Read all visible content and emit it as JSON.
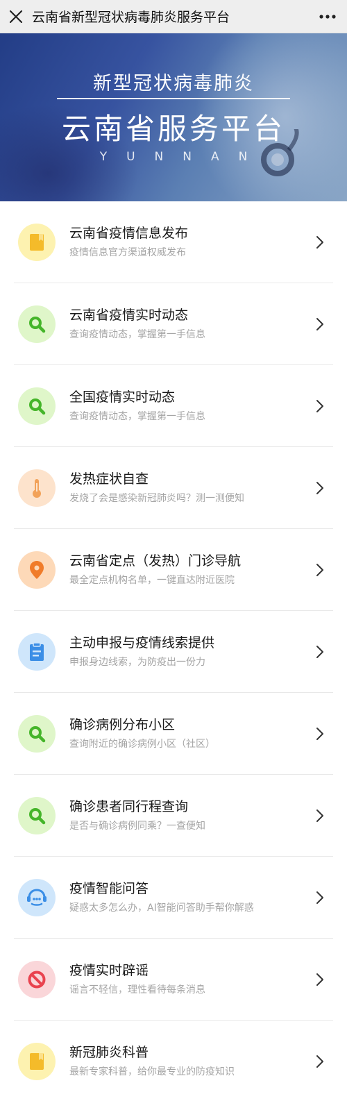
{
  "header": {
    "title": "云南省新型冠状病毒肺炎服务平台",
    "close_icon": "close-icon",
    "more_icon": "more-icon"
  },
  "banner": {
    "subtitle": "新型冠状病毒肺炎",
    "title": "云南省服务平台",
    "english": "YUNNAN"
  },
  "colors": {
    "yellow_bg": "#fdf2b0",
    "yellow_fg": "#f4bb2a",
    "green_bg": "#dff6c9",
    "green_fg": "#45b52a",
    "peach_bg": "#fde3cc",
    "peach_fg": "#f2a259",
    "orange_bg": "#fdd9b8",
    "orange_fg": "#f07c2a",
    "blue_bg": "#cfe6fb",
    "blue_fg": "#3b8ee6",
    "pink_bg": "#fad6d9",
    "pink_fg": "#e9434f"
  },
  "items": [
    {
      "title": "云南省疫情信息发布",
      "desc": "疫情信息官方渠道权威发布",
      "icon": "document-icon"
    },
    {
      "title": "云南省疫情实时动态",
      "desc": "查询疫情动态，掌握第一手信息",
      "icon": "search-icon"
    },
    {
      "title": "全国疫情实时动态",
      "desc": "查询疫情动态，掌握第一手信息",
      "icon": "search-icon"
    },
    {
      "title": "发热症状自查",
      "desc": "发烧了会是感染新冠肺炎吗？测一测便知",
      "icon": "thermometer-icon"
    },
    {
      "title": "云南省定点（发热）门诊导航",
      "desc": "最全定点机构名单，一键直达附近医院",
      "icon": "location-pin-icon"
    },
    {
      "title": "主动申报与疫情线索提供",
      "desc": "申报身边线索，为防疫出一份力",
      "icon": "clipboard-icon"
    },
    {
      "title": "确诊病例分布小区",
      "desc": "查询附近的确诊病例小区（社区）",
      "icon": "search-icon"
    },
    {
      "title": "确诊患者同行程查询",
      "desc": "是否与确诊病例同乘？一查便知",
      "icon": "search-icon"
    },
    {
      "title": "疫情智能问答",
      "desc": "疑惑太多怎么办，AI智能问答助手帮你解惑",
      "icon": "chat-bot-icon"
    },
    {
      "title": "疫情实时辟谣",
      "desc": "谣言不轻信，理性看待每条消息",
      "icon": "prohibited-icon"
    },
    {
      "title": "新冠肺炎科普",
      "desc": "最新专家科普，给你最专业的防疫知识",
      "icon": "document-icon"
    }
  ]
}
